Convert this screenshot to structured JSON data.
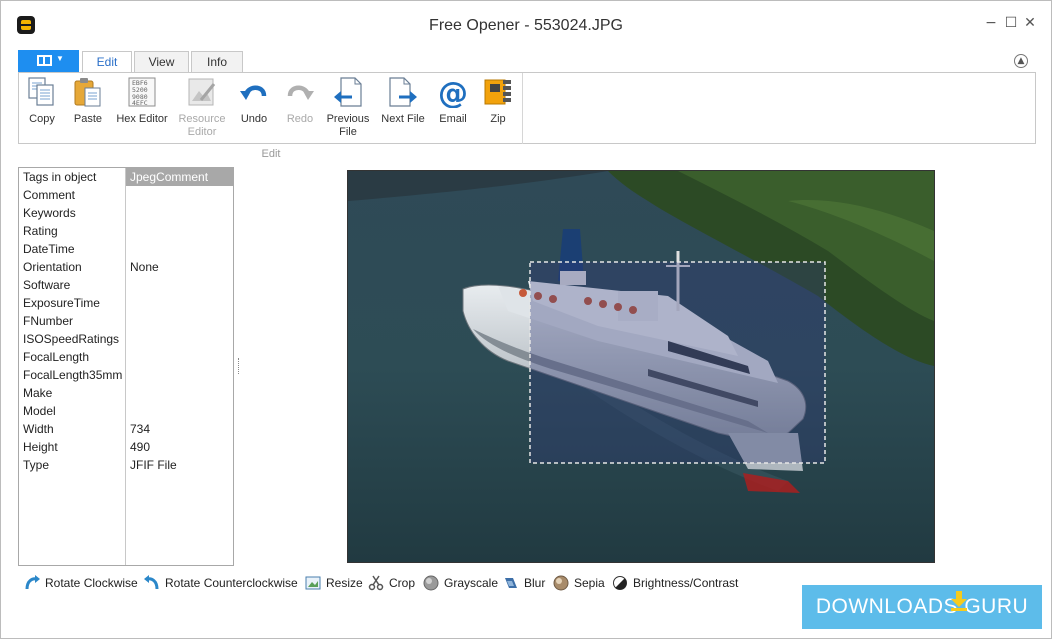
{
  "window": {
    "title": "Free Opener - 553024.JPG",
    "controls": {
      "minimize": "−",
      "maximize": "☐",
      "close": "✕"
    }
  },
  "tabs": [
    {
      "label": "Edit",
      "active": true
    },
    {
      "label": "View",
      "active": false
    },
    {
      "label": "Info",
      "active": false
    }
  ],
  "ribbon": {
    "group_label": "Edit",
    "buttons": [
      {
        "label": "Copy",
        "icon": "copy-icon",
        "enabled": true
      },
      {
        "label": "Paste",
        "icon": "paste-icon",
        "enabled": true
      },
      {
        "label": "Hex Editor",
        "icon": "hex-editor-icon",
        "enabled": true
      },
      {
        "label": "Resource\nEditor",
        "icon": "resource-editor-icon",
        "enabled": false
      },
      {
        "label": "Undo",
        "icon": "undo-icon",
        "enabled": true
      },
      {
        "label": "Redo",
        "icon": "redo-icon",
        "enabled": false
      },
      {
        "label": "Previous\nFile",
        "icon": "previous-file-icon",
        "enabled": true
      },
      {
        "label": "Next File",
        "icon": "next-file-icon",
        "enabled": true
      },
      {
        "label": "Email",
        "icon": "email-icon",
        "enabled": true
      },
      {
        "label": "Zip",
        "icon": "zip-icon",
        "enabled": true
      }
    ],
    "hex_icon_text": [
      "EBF6",
      "5200",
      "9080",
      "4EFC"
    ]
  },
  "tags": {
    "header": {
      "key": "Tags in object",
      "value": "JpegComment"
    },
    "rows": [
      {
        "key": "Comment",
        "value": ""
      },
      {
        "key": "Keywords",
        "value": ""
      },
      {
        "key": "Rating",
        "value": ""
      },
      {
        "key": "DateTime",
        "value": ""
      },
      {
        "key": "Orientation",
        "value": "None"
      },
      {
        "key": "Software",
        "value": ""
      },
      {
        "key": "ExposureTime",
        "value": ""
      },
      {
        "key": "FNumber",
        "value": ""
      },
      {
        "key": "ISOSpeedRatings",
        "value": ""
      },
      {
        "key": "FocalLength",
        "value": ""
      },
      {
        "key": "FocalLength35mm",
        "value": ""
      },
      {
        "key": "Make",
        "value": ""
      },
      {
        "key": "Model",
        "value": ""
      },
      {
        "key": "Width",
        "value": "734"
      },
      {
        "key": "Height",
        "value": "490"
      },
      {
        "key": "Type",
        "value": "JFIF File"
      }
    ]
  },
  "tools": [
    {
      "label": "Rotate Clockwise",
      "icon": "rotate-clockwise-icon"
    },
    {
      "label": "Rotate Counterclockwise",
      "icon": "rotate-counterclockwise-icon"
    },
    {
      "label": "Resize",
      "icon": "resize-icon"
    },
    {
      "label": "Crop",
      "icon": "crop-icon"
    },
    {
      "label": "Grayscale",
      "icon": "grayscale-icon"
    },
    {
      "label": "Blur",
      "icon": "blur-icon"
    },
    {
      "label": "Sepia",
      "icon": "sepia-icon"
    },
    {
      "label": "Brightness/Contrast",
      "icon": "brightness-contrast-icon"
    }
  ],
  "watermark": {
    "text": "DOWNLOADS  GURU"
  },
  "colors": {
    "accent": "#1e8ef0",
    "active_tab_text": "#2a6fc9",
    "icon_blue": "#1f6fbf",
    "disabled": "#a9a9a9",
    "watermark_bg": "#47b3e8"
  }
}
